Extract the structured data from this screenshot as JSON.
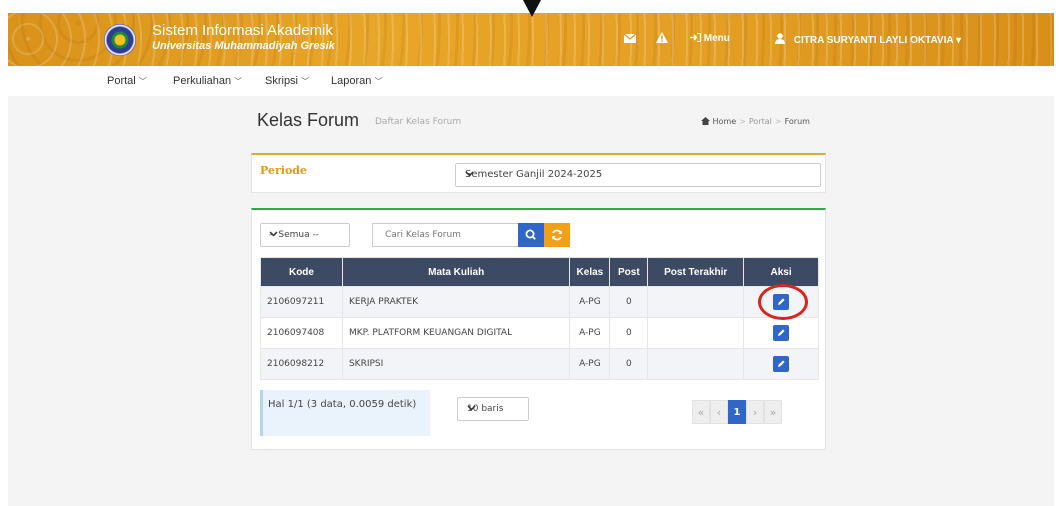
{
  "header": {
    "title": "Sistem Informasi Akademik",
    "subtitle": "Universitas Muhammadiyah Gresik",
    "menu_label": "Menu",
    "user_name": "CITRA SURYANTI LAYLI OKTAVIA"
  },
  "nav": {
    "items": [
      {
        "label": "Portal"
      },
      {
        "label": "Perkuliahan"
      },
      {
        "label": "Skripsi"
      },
      {
        "label": "Laporan"
      }
    ]
  },
  "page": {
    "title": "Kelas Forum",
    "subtitle": "Daftar Kelas Forum",
    "breadcrumb": [
      "Home",
      "Portal",
      "Forum"
    ]
  },
  "periode": {
    "label": "Periode",
    "value": "Semester Ganjil 2024-2025"
  },
  "filter": {
    "value": "-- Semua --",
    "search_placeholder": "Cari Kelas Forum"
  },
  "table": {
    "headers": [
      "Kode",
      "Mata Kuliah",
      "Kelas",
      "Post",
      "Post Terakhir",
      "Aksi"
    ],
    "rows": [
      {
        "kode": "2106097211",
        "mata_kuliah": "KERJA PRAKTEK",
        "kelas": "A-PG",
        "post": "0",
        "post_terakhir": ""
      },
      {
        "kode": "2106097408",
        "mata_kuliah": "MKP. PLATFORM KEUANGAN DIGITAL",
        "kelas": "A-PG",
        "post": "0",
        "post_terakhir": ""
      },
      {
        "kode": "2106098212",
        "mata_kuliah": "SKRIPSI",
        "kelas": "A-PG",
        "post": "0",
        "post_terakhir": ""
      }
    ]
  },
  "footer": {
    "info": "Hal 1/1 (3 data, 0.0059 detik)",
    "rows_per_page": "10 baris",
    "pagination": {
      "first": "«",
      "prev": "‹",
      "current": "1",
      "next": "›",
      "last": "»"
    }
  },
  "colors": {
    "header_orange": "#e8a628",
    "table_header": "#3d4a63",
    "primary_blue": "#2f66c7",
    "refresh_orange": "#f2a018",
    "highlight_red": "#d9261c"
  },
  "icons": [
    "university-logo",
    "envelope-icon",
    "warning-icon",
    "sign-in-icon",
    "user-icon",
    "search-icon",
    "refresh-icon",
    "edit-icon",
    "home-icon",
    "chevron-down-icon"
  ]
}
